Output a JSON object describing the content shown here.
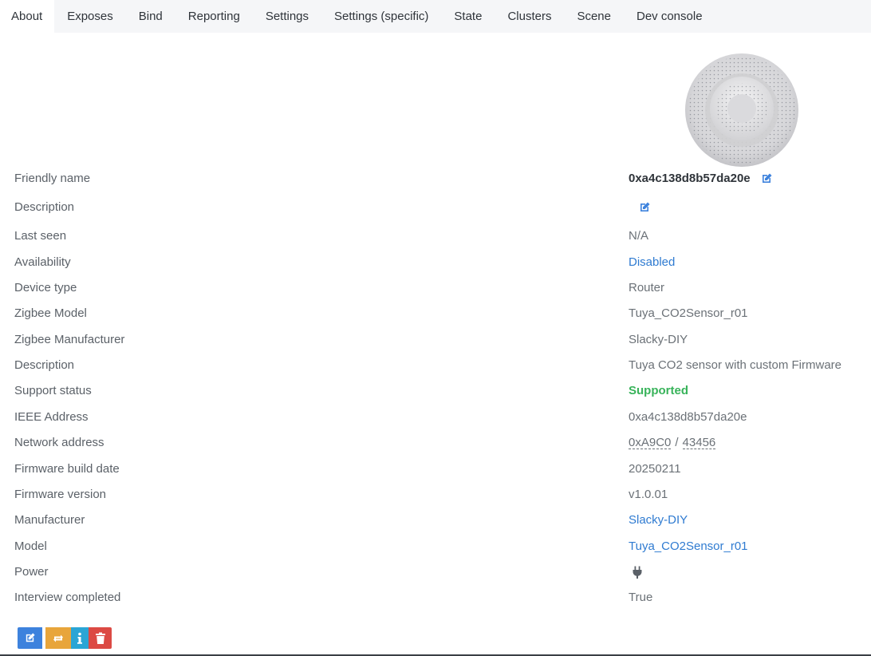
{
  "tabs": [
    {
      "label": "About",
      "active": true
    },
    {
      "label": "Exposes"
    },
    {
      "label": "Bind"
    },
    {
      "label": "Reporting"
    },
    {
      "label": "Settings"
    },
    {
      "label": "Settings (specific)"
    },
    {
      "label": "State"
    },
    {
      "label": "Clusters"
    },
    {
      "label": "Scene"
    },
    {
      "label": "Dev console"
    }
  ],
  "device": {
    "friendly_name_label": "Friendly name",
    "friendly_name": "0xa4c138d8b57da20e",
    "description_label": "Description",
    "last_seen_label": "Last seen",
    "last_seen": "N/A",
    "availability_label": "Availability",
    "availability": "Disabled",
    "device_type_label": "Device type",
    "device_type": "Router",
    "zigbee_model_label": "Zigbee Model",
    "zigbee_model": "Tuya_CO2Sensor_r01",
    "zigbee_manufacturer_label": "Zigbee Manufacturer",
    "zigbee_manufacturer": "Slacky-DIY",
    "description2_label": "Description",
    "description2": "Tuya CO2 sensor with custom Firmware",
    "support_status_label": "Support status",
    "support_status": "Supported",
    "ieee_label": "IEEE Address",
    "ieee": "0xa4c138d8b57da20e",
    "network_address_label": "Network address",
    "network_address_hex": "0xA9C0",
    "network_address_sep": "/",
    "network_address_dec": "43456",
    "fw_build_date_label": "Firmware build date",
    "fw_build_date": "20250211",
    "fw_version_label": "Firmware version",
    "fw_version": "v1.0.01",
    "manufacturer_label": "Manufacturer",
    "manufacturer": "Slacky-DIY",
    "model_label": "Model",
    "model": "Tuya_CO2Sensor_r01",
    "power_label": "Power",
    "power_icon": "plug-icon",
    "interview_label": "Interview completed",
    "interview": "True"
  },
  "icons": {
    "edit": "edit-icon",
    "interview": "refresh-icon",
    "info": "info-icon",
    "remove": "trash-icon"
  },
  "colors": {
    "link": "#2f7bd1",
    "success": "#38b35a",
    "edit_button": "#3d82dd",
    "interview_button": "#e8a53b",
    "info_button": "#2aa5d5",
    "remove_button": "#dc4a44"
  }
}
